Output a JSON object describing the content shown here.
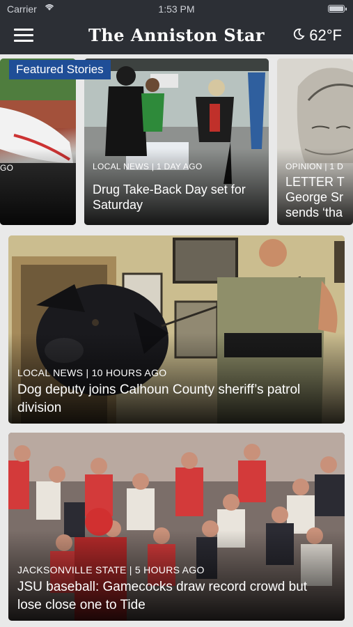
{
  "status_bar": {
    "carrier": "Carrier",
    "time": "1:53 PM"
  },
  "header": {
    "title": "The Anniston Star",
    "weather": "62°F",
    "menu_icon": "hamburger-menu-icon",
    "weather_icon": "moon-icon"
  },
  "carousel": {
    "badge": "Featured Stories",
    "cards": [
      {
        "category": "GO",
        "headline": ""
      },
      {
        "category": "LOCAL NEWS | 1 DAY AGO",
        "headline": "Drug Take-Back Day set for Saturday"
      },
      {
        "category": "OPINION | 1 D",
        "headline_lines": [
          "LETTER T",
          "George Sr",
          "sends ‘tha"
        ]
      }
    ]
  },
  "stories": [
    {
      "category": "LOCAL NEWS | 10 HOURS AGO",
      "headline": "Dog deputy joins Calhoun County sheriff’s patrol division"
    },
    {
      "category": "JACKSONVILLE STATE | 5 HOURS AGO",
      "headline": "JSU baseball: Gamecocks draw record crowd but lose close one to Tide"
    }
  ],
  "colors": {
    "bar": "#2c2f35",
    "badge": "#1f4e97",
    "background": "#e9e9e9"
  }
}
